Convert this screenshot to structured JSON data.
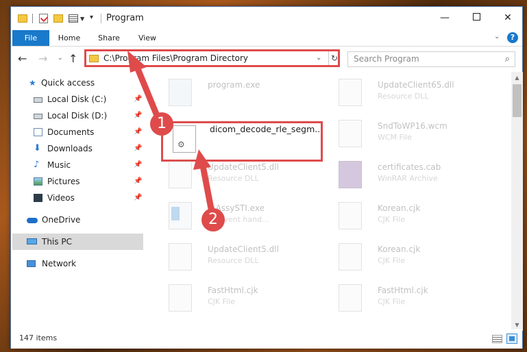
{
  "window": {
    "title": "Program",
    "controls": {
      "minimize": "—",
      "maximize": "",
      "close": "✕"
    }
  },
  "ribbon": {
    "tabs": [
      "File",
      "Home",
      "Share",
      "View"
    ],
    "expand_glyph": "⌄",
    "help_glyph": "?"
  },
  "address": {
    "path": "C:\\Program Files\\Program Directory",
    "dropdown_glyph": "⌄",
    "refresh_glyph": "↻"
  },
  "nav_glyphs": {
    "back": "←",
    "forward": "→",
    "recent": "⌄",
    "up": "↑"
  },
  "search": {
    "placeholder": "Search Program",
    "icon_glyph": "⌕"
  },
  "sidebar": {
    "items": [
      {
        "label": "Quick access",
        "icon": "star-icon",
        "pinned": false
      },
      {
        "label": "Local Disk (C:)",
        "icon": "drive-icon",
        "pinned": true
      },
      {
        "label": "Local Disk (D:)",
        "icon": "drive-icon",
        "pinned": true
      },
      {
        "label": "Documents",
        "icon": "documents-icon",
        "pinned": true
      },
      {
        "label": "Downloads",
        "icon": "download-icon",
        "pinned": true
      },
      {
        "label": "Music",
        "icon": "music-icon",
        "pinned": true
      },
      {
        "label": "Pictures",
        "icon": "pictures-icon",
        "pinned": true
      },
      {
        "label": "Videos",
        "icon": "videos-icon",
        "pinned": true
      },
      {
        "label": "OneDrive",
        "icon": "onedrive-icon",
        "pinned": false
      },
      {
        "label": "This PC",
        "icon": "pc-icon",
        "pinned": false,
        "selected": true
      },
      {
        "label": "Network",
        "icon": "network-icon",
        "pinned": false
      }
    ],
    "pin_glyph": "📌"
  },
  "files": [
    {
      "name": "program.exe",
      "type": "",
      "icon": "exe-icon"
    },
    {
      "name": "UpdateClient65.dll",
      "type": "Resource DLL",
      "icon": "dll-icon"
    },
    {
      "name": "dicom_decode_rle_segm...",
      "type": "",
      "icon": "dll-icon",
      "highlighted": true
    },
    {
      "name": "SndToWP16.wcm",
      "type": "WCM File",
      "icon": "file-icon"
    },
    {
      "name": "UpdateClient5.dll",
      "type": "Resource DLL",
      "icon": "dll-icon"
    },
    {
      "name": "certificates.cab",
      "type": "WinRAR Archive",
      "icon": "cab-icon"
    },
    {
      "name": "AiAssySTI.exe",
      "type": "sti event hand...",
      "icon": "app-icon"
    },
    {
      "name": "Korean.cjk",
      "type": "CJK File",
      "icon": "file-icon"
    },
    {
      "name": "UpdateClient5.dll",
      "type": "Resource DLL",
      "icon": "dll-icon"
    },
    {
      "name": "Korean.cjk",
      "type": "CJK File",
      "icon": "file-icon"
    },
    {
      "name": "FastHtml.cjk",
      "type": "CJK File",
      "icon": "file-icon"
    },
    {
      "name": "FastHtml.cjk",
      "type": "CJK File",
      "icon": "file-icon"
    }
  ],
  "status": {
    "item_count": "147 items"
  },
  "annotations": {
    "step1": "1",
    "step2": "2",
    "color": "#df4b4b"
  },
  "scroll_glyphs": {
    "up": "▲",
    "down": "▼"
  },
  "colors": {
    "accent": "#1979ca",
    "highlight": "#df4b4b",
    "selection": "#d9d9d9"
  }
}
